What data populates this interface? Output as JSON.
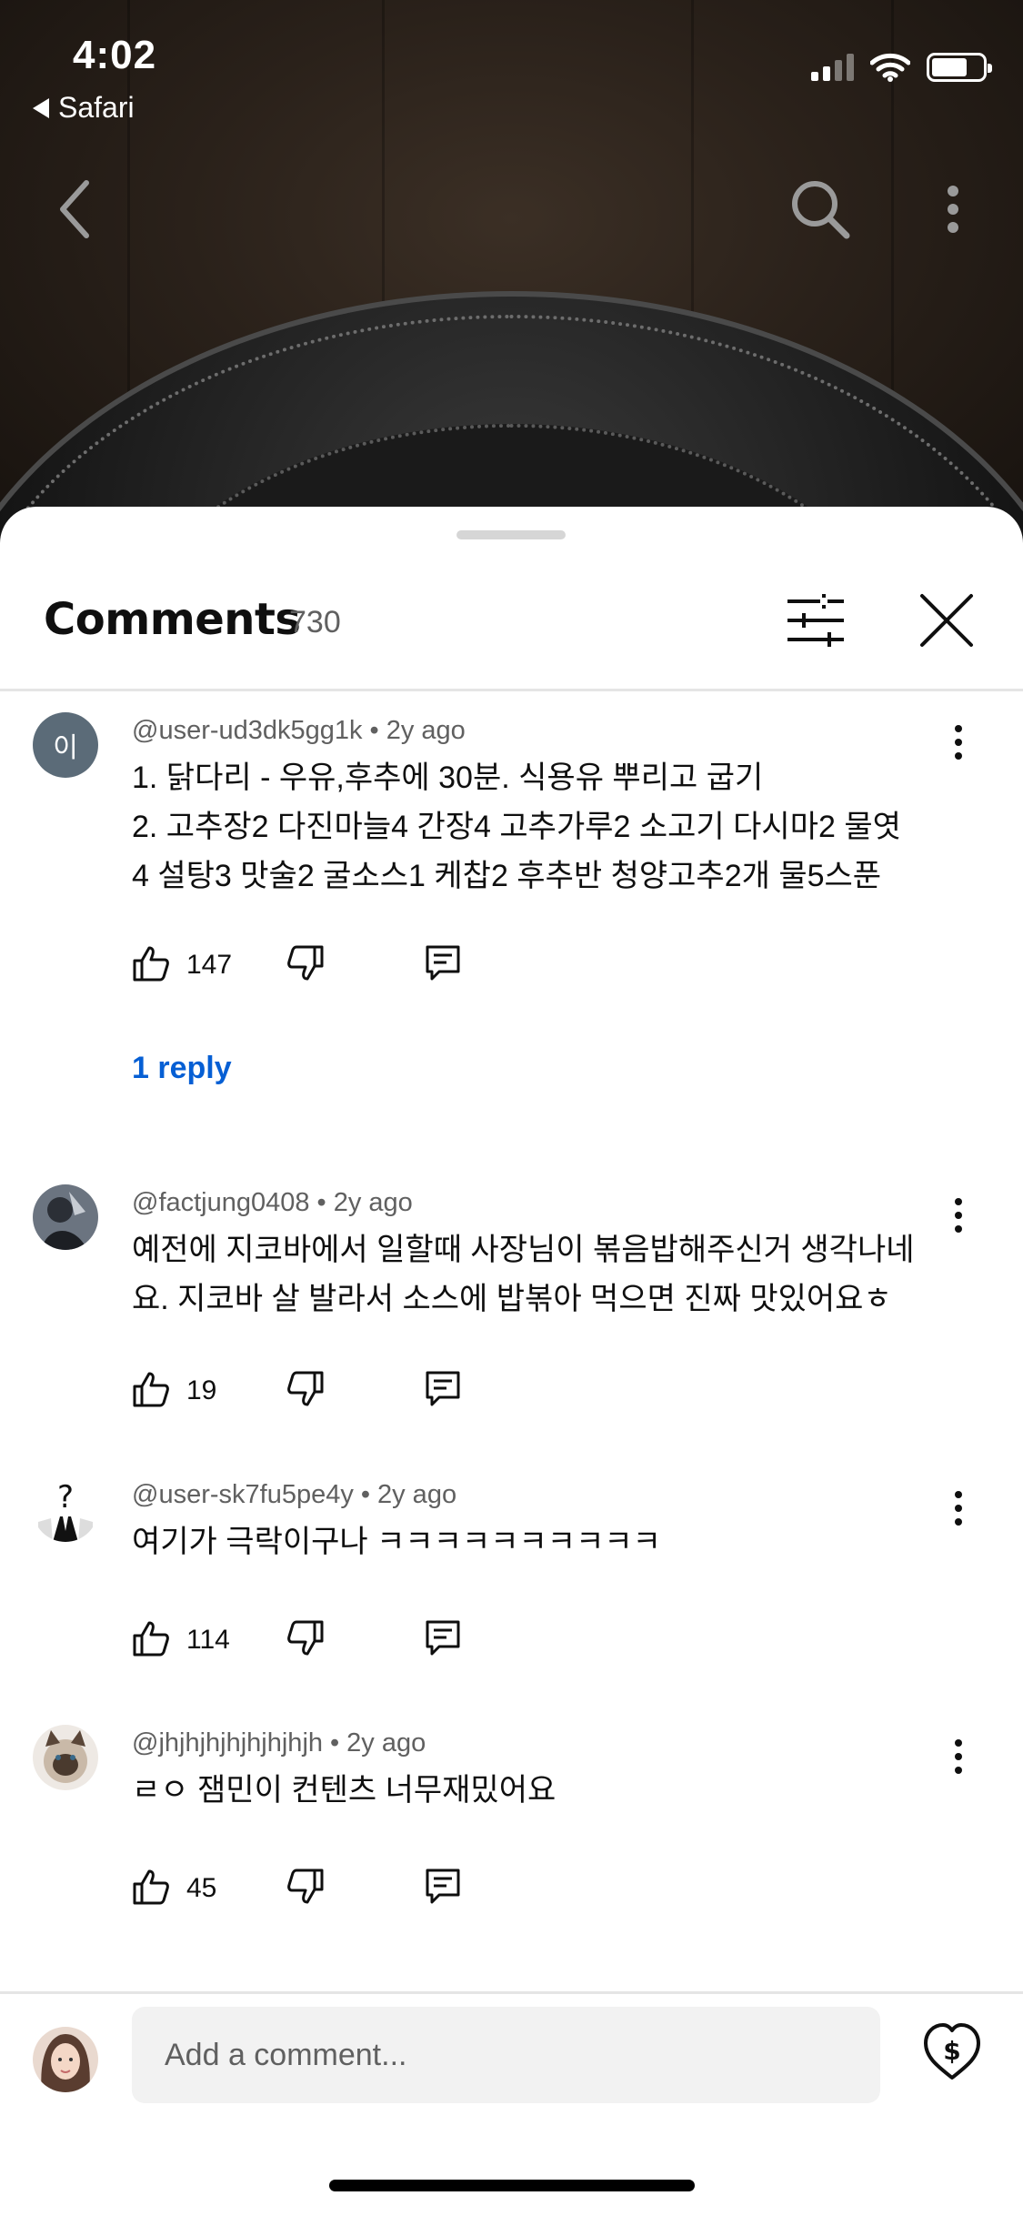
{
  "status_bar": {
    "time": "4:02",
    "back_app": "Safari",
    "icons": [
      "cellular-signal-icon",
      "wifi-icon",
      "battery-icon"
    ]
  },
  "video": {
    "icons": [
      "back-arrow-icon",
      "search-icon",
      "more-vertical-icon"
    ]
  },
  "comments_panel": {
    "title": "Comments",
    "count": "730",
    "icons": [
      "filter-sliders-icon",
      "close-icon"
    ],
    "comments": [
      {
        "avatar_letter": "이",
        "author": "@user-ud3dk5gg1k",
        "separator": "•",
        "age": "2y ago",
        "lines": [
          "1.  닭다리 - 우유,후추에 30분. 식용유 뿌리고 굽기",
          "2.  고추장2 다진마늘4 간장4 고추가루2 소고기 다시마2  물엿",
          "4  설탕3  맛술2  굴소스1 케찹2 후추반 청양고추2개 물5스푼"
        ],
        "likes": "147",
        "replies": "1 reply"
      },
      {
        "author": "@factjung0408",
        "separator": "•",
        "age": "2y ago",
        "lines": [
          "예전에 지코바에서 일할때 사장님이 볶음밥해주신거 생각나네",
          "요. 지코바 살 발라서 소스에 밥볶아 먹으면 진짜 맛있어요ㅎ"
        ],
        "likes": "19"
      },
      {
        "author": "@user-sk7fu5pe4y",
        "separator": "•",
        "age": "2y ago",
        "lines": [
          "여기가 극락이구나 ㅋㅋㅋㅋㅋㅋㅋㅋㅋㅋ"
        ],
        "likes": "114"
      },
      {
        "author": "@jhjhjhjhjhjhjhjh",
        "separator": "•",
        "age": "2y ago",
        "lines": [
          "ㄹㅇ 잼민이 컨텐츠 너무재밌어요"
        ],
        "likes": "45"
      }
    ],
    "composer": {
      "placeholder": "Add a comment...",
      "icons": [
        "user-avatar",
        "super-thanks-heart-dollar-icon"
      ]
    }
  },
  "colors": {
    "link_blue": "#065fd4",
    "text_primary": "#0f0f0f",
    "text_secondary": "#606060",
    "avatar_letter_bg": "#5b6b78"
  }
}
